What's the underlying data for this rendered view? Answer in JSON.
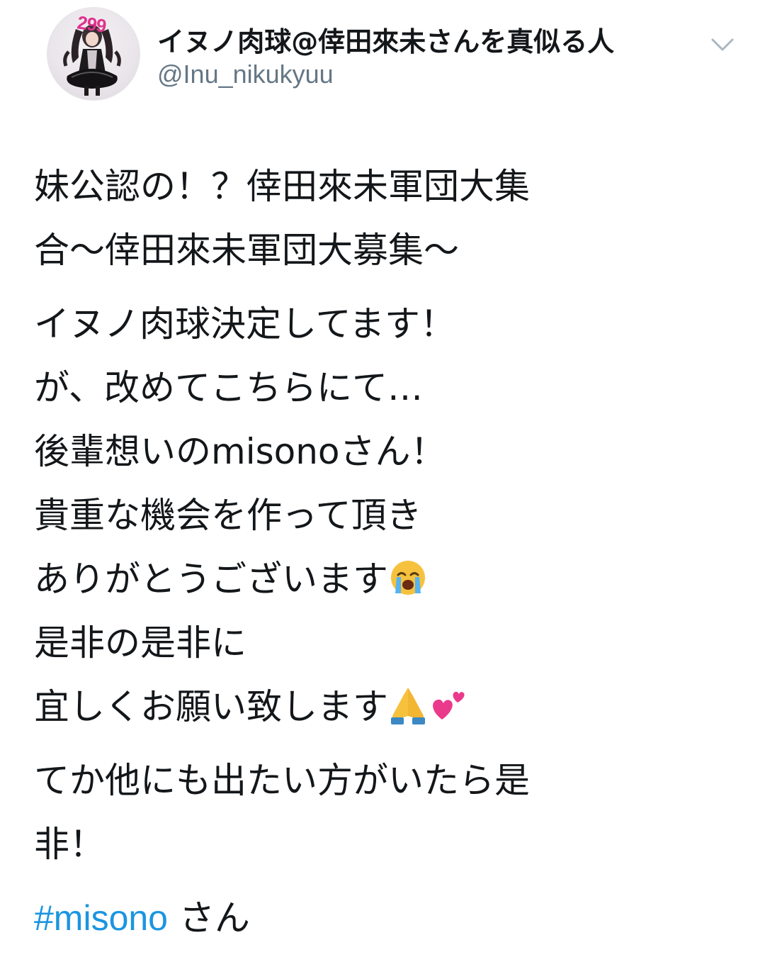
{
  "tweet": {
    "display_name": "イヌノ肉球@倖田來未さんを真似る人",
    "username": "@Inu_nikukyuu",
    "avatar_badge": "299",
    "body": {
      "p1": [
        "妹公認の！？倖田來未軍団大集",
        "合〜倖田來未軍団大募集〜"
      ],
      "p2": [
        "イヌノ肉球決定してます！",
        "が、改めてこちらにて…",
        "後輩想いのmisonoさん！",
        "貴重な機会を作って頂き",
        "ありがとうございます",
        "是非の是非に",
        "宜しくお願い致します"
      ],
      "p3": [
        "てか他にも出たい方がいたら是",
        "非！"
      ]
    },
    "hashtag": "#misono",
    "hashtag_suffix": " さん",
    "emojis": [
      "loudly-crying-face",
      "folded-hands",
      "two-hearts"
    ],
    "colors": {
      "text": "#14171a",
      "secondary": "#657786",
      "link": "#1b95e0",
      "badge": "#e0328e"
    }
  }
}
